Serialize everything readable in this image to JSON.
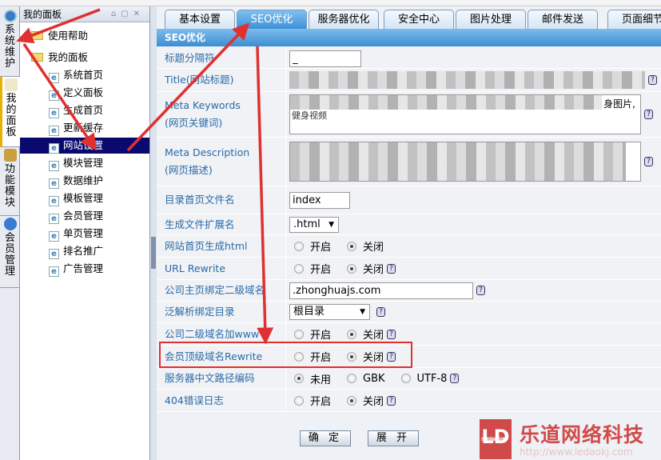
{
  "left_tabs": [
    {
      "label": "系统维护",
      "icon": "clock-icon"
    },
    {
      "label": "我的面板",
      "icon": "home-icon",
      "active": true
    },
    {
      "label": "功能模块",
      "icon": "gear-icon"
    },
    {
      "label": "会员管理",
      "icon": "user-icon"
    }
  ],
  "sidebar": {
    "title": "我的面板",
    "help": "使用帮助",
    "folder": "我的面板",
    "items": [
      "系统首页",
      "定义面板",
      "生成首页",
      "更新缓存",
      "网站设置",
      "模块管理",
      "数据维护",
      "模板管理",
      "会员管理",
      "单页管理",
      "排名推广",
      "广告管理"
    ],
    "selected": "网站设置"
  },
  "tabs": [
    "基本设置",
    "SEO优化",
    "服务器优化",
    "安全中心",
    "图片处理",
    "邮件发送",
    "页面细节"
  ],
  "active_tab": "SEO优化",
  "section_title": "SEO优化",
  "fields": {
    "separator": {
      "label": "标题分隔符",
      "value": "_"
    },
    "title": {
      "label": "Title(网站标题)"
    },
    "keywords": {
      "label1": "Meta Keywords",
      "label2": "(网页关键词)",
      "visible_text": "身图片,",
      "visible_text2": "健身视频"
    },
    "description": {
      "label1": "Meta Description",
      "label2": "(网页描述)"
    },
    "index_name": {
      "label": "目录首页文件名",
      "value": "index"
    },
    "ext": {
      "label": "生成文件扩展名",
      "value": ".html"
    },
    "home_html": {
      "label": "网站首页生成html",
      "options": [
        "开启",
        "关闭"
      ],
      "selected": "关闭"
    },
    "url_rewrite": {
      "label": "URL Rewrite",
      "options": [
        "开启",
        "关闭"
      ],
      "selected": "关闭"
    },
    "subdomain": {
      "label": "公司主页绑定二级域名",
      "value": ".zhonghuajs.com"
    },
    "wildcard_dir": {
      "label": "泛解析绑定目录",
      "value": "根目录"
    },
    "www": {
      "label": "公司二级域名加www",
      "options": [
        "开启",
        "关闭"
      ],
      "selected": "关闭"
    },
    "member_rewrite": {
      "label": "会员顶级域名Rewrite",
      "options": [
        "开启",
        "关闭"
      ],
      "selected": "关闭"
    },
    "path_encoding": {
      "label": "服务器中文路径编码",
      "options": [
        "未用",
        "GBK",
        "UTF-8"
      ],
      "selected": "未用"
    },
    "log404": {
      "label": "404错误日志",
      "options": [
        "开启",
        "关闭"
      ],
      "selected": "关闭"
    }
  },
  "buttons": {
    "confirm": "确 定",
    "expand": "展 开"
  },
  "watermark": {
    "logo": "LD",
    "name": "乐道网络科技",
    "url": "http://www.ledaokj.com"
  },
  "colors": {
    "accent": "#3d8dd3",
    "selected": "#0a0a6e",
    "annotation": "#e03030"
  }
}
